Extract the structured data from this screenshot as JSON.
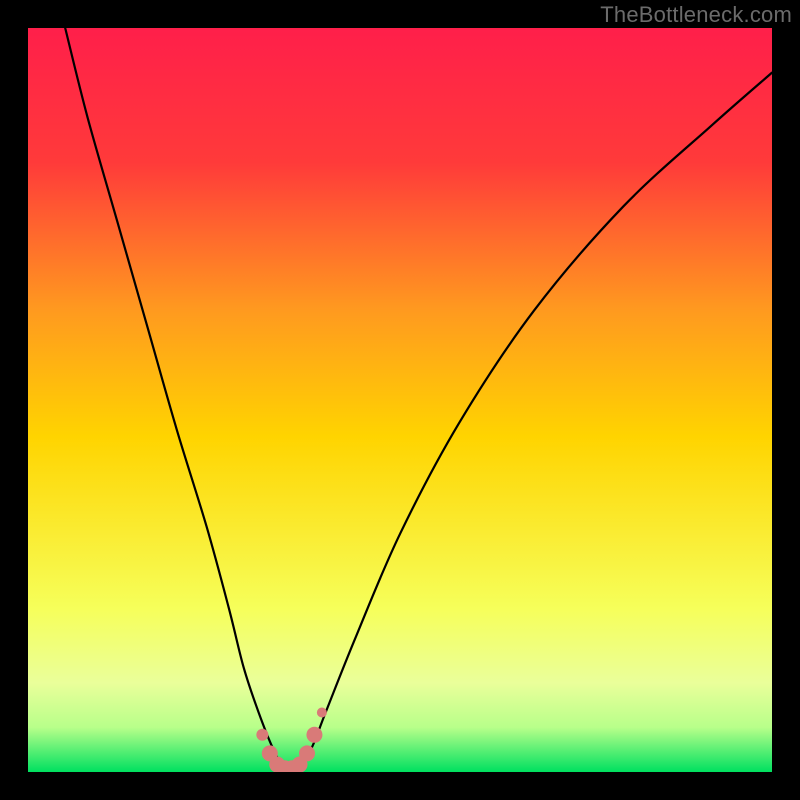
{
  "watermark": "TheBottleneck.com",
  "chart_data": {
    "type": "line",
    "title": "",
    "xlabel": "",
    "ylabel": "",
    "xlim": [
      0,
      100
    ],
    "ylim": [
      0,
      100
    ],
    "grid": false,
    "legend": false,
    "annotations": [],
    "background_gradient": {
      "top": "#ff1f4a",
      "upper_mid": "#ff7a2a",
      "mid": "#ffd400",
      "lower_mid": "#f4ff70",
      "near_bottom": "#b8ff8a",
      "bottom": "#00e060"
    },
    "series": [
      {
        "name": "bottleneck-curve",
        "x": [
          5,
          8,
          12,
          16,
          20,
          24,
          27,
          29,
          31,
          33,
          34.5,
          36,
          38,
          40,
          44,
          50,
          58,
          68,
          80,
          92,
          100
        ],
        "y": [
          100,
          88,
          74,
          60,
          46,
          33,
          22,
          14,
          8,
          3,
          0.5,
          0.5,
          3,
          8,
          18,
          32,
          47,
          62,
          76,
          87,
          94
        ]
      }
    ],
    "marker_series": {
      "name": "valley-markers",
      "color": "#d97a78",
      "points": [
        {
          "x": 31.5,
          "y": 5,
          "r": 6
        },
        {
          "x": 32.5,
          "y": 2.5,
          "r": 8
        },
        {
          "x": 33.5,
          "y": 1,
          "r": 8
        },
        {
          "x": 34.5,
          "y": 0.5,
          "r": 8
        },
        {
          "x": 35.5,
          "y": 0.5,
          "r": 8
        },
        {
          "x": 36.5,
          "y": 1,
          "r": 8
        },
        {
          "x": 37.5,
          "y": 2.5,
          "r": 8
        },
        {
          "x": 38.5,
          "y": 5,
          "r": 8
        },
        {
          "x": 39.5,
          "y": 8,
          "r": 5
        }
      ]
    }
  }
}
